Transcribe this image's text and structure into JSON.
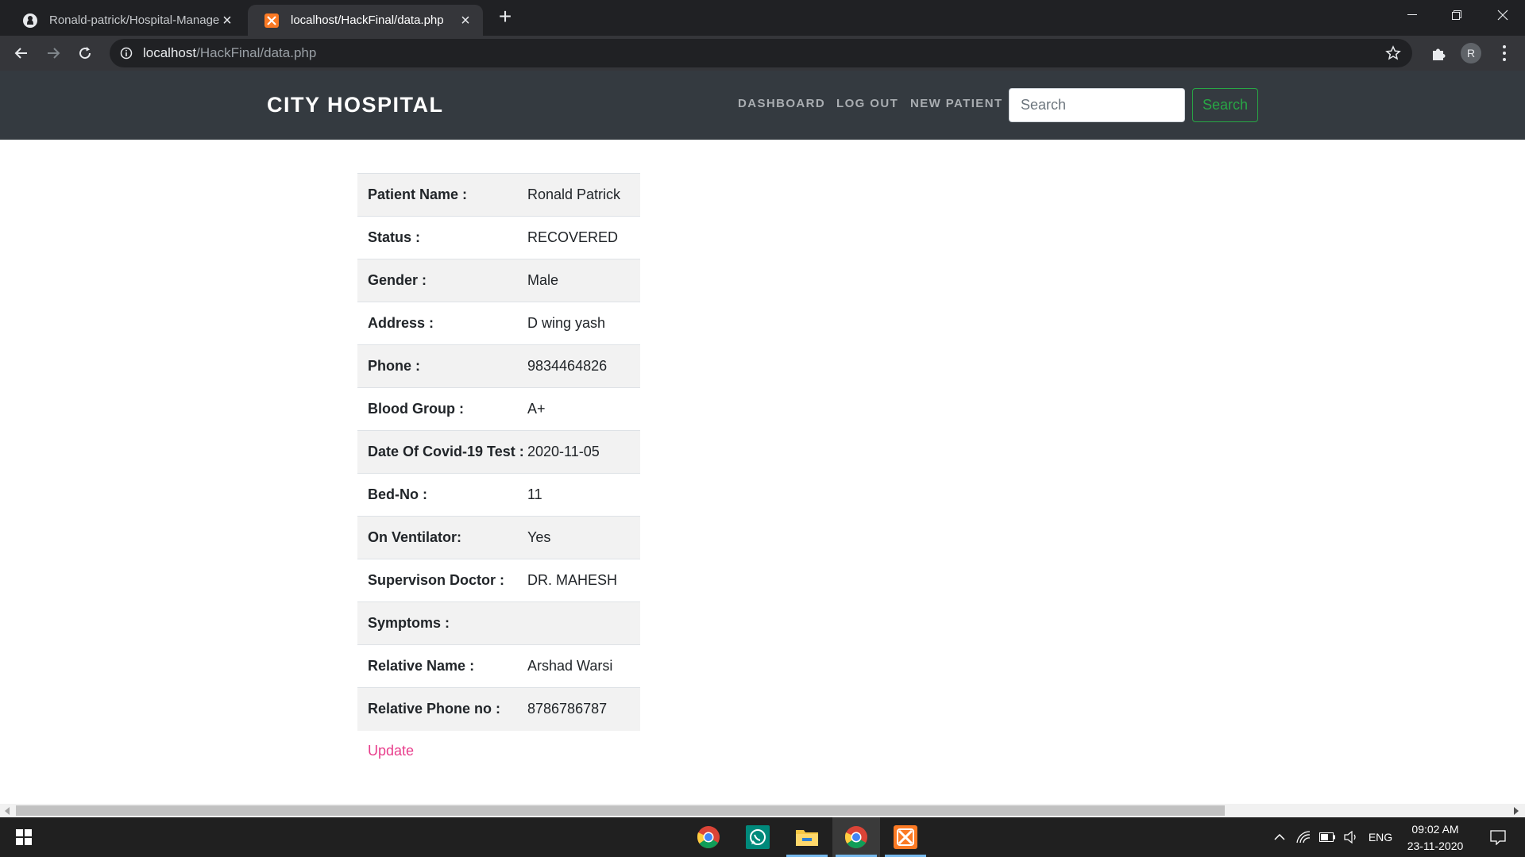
{
  "browser": {
    "tabs": [
      {
        "title": "Ronald-patrick/Hospital-Management",
        "active": false
      },
      {
        "title": "localhost/HackFinal/data.php",
        "active": true
      }
    ],
    "url_host": "localhost",
    "url_path": "/HackFinal/data.php",
    "profile_initial": "R"
  },
  "site": {
    "brand": "CITY HOSPITAL",
    "nav": [
      "DASHBOARD",
      "LOG OUT",
      "NEW PATIENT"
    ],
    "search_placeholder": "Search",
    "search_button": "Search"
  },
  "patient": {
    "rows": [
      {
        "label": "Patient Name :",
        "value": "Ronald Patrick"
      },
      {
        "label": "Status :",
        "value": "RECOVERED"
      },
      {
        "label": "Gender :",
        "value": "Male"
      },
      {
        "label": "Address :",
        "value": "D wing yash"
      },
      {
        "label": "Phone :",
        "value": "9834464826"
      },
      {
        "label": "Blood Group :",
        "value": "A+"
      },
      {
        "label": "Date Of Covid-19 Test :",
        "value": "2020-11-05"
      },
      {
        "label": "Bed-No :",
        "value": "11"
      },
      {
        "label": "On Ventilator:",
        "value": "Yes"
      },
      {
        "label": "Supervison Doctor :",
        "value": "DR. MAHESH"
      },
      {
        "label": "Symptoms :",
        "value": ""
      },
      {
        "label": "Relative Name :",
        "value": "Arshad Warsi"
      },
      {
        "label": "Relative Phone no :",
        "value": "8786786787"
      }
    ],
    "update_link": "Update"
  },
  "taskbar": {
    "apps": [
      "chrome-icon",
      "whatsapp-icon",
      "file-explorer-icon",
      "chrome-icon",
      "xampp-icon"
    ],
    "language": "ENG",
    "time": "09:02 AM",
    "date": "23-11-2020"
  },
  "colors": {
    "navbar": "#343a40",
    "success": "#28a745",
    "link": "#e83e8c",
    "stripe": "#f2f2f2"
  }
}
